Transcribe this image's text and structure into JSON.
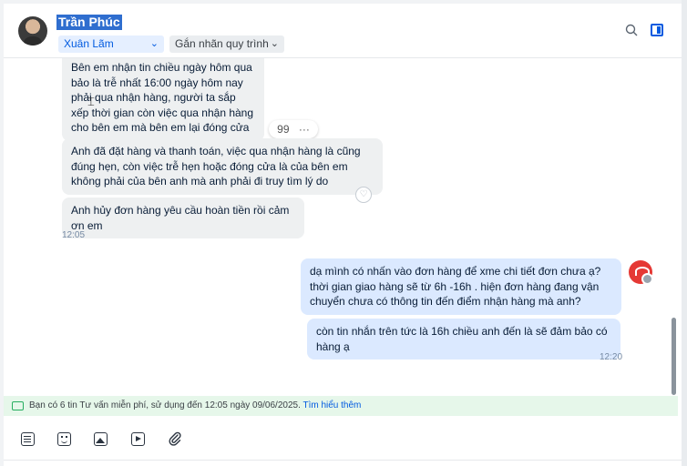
{
  "header": {
    "contact_name": "Trần Phúc",
    "assignee_select": "Xuân Lãm",
    "tag_select": "Gắn nhãn quy trình",
    "icons": [
      "search-icon",
      "toggle-panel-icon"
    ]
  },
  "messages": [
    {
      "side": "in",
      "text": "Bên em nhận tin chiều ngày hôm qua bảo là trễ nhất 16:00 ngày hôm nay phải qua nhận hàng, người ta sắp xếp thời gian còn việc qua nhận hàng cho bên em mà bên em lại đóng cửa"
    },
    {
      "side": "in",
      "text": "Anh đã đặt hàng và thanh toán, việc qua nhận hàng là cũng đúng hẹn, còn việc trễ hẹn hoặc đóng cửa là của bên em không phải của bên anh mà anh phải đi truy tìm lý do"
    },
    {
      "side": "in",
      "text": "Anh hủy đơn hàng yêu cầu hoàn tiền rồi cảm ơn em"
    },
    {
      "side": "out",
      "text": "dạ mình có nhấn vào đơn hàng để xme chi tiết đơn chưa ạ? thời gian giao hàng sẽ từ 6h -16h . hiện đơn hàng đang vận chuyển chưa có thông tin đến điểm nhận hàng mà anh?"
    },
    {
      "side": "out",
      "text": "còn tin nhắn trên tức là 16h chiều anh đến là sẽ đảm bảo có hàng ạ"
    }
  ],
  "times": {
    "incoming": "12:05",
    "outgoing": "12:20"
  },
  "reaction_bar": {
    "quote": "99",
    "more": "···"
  },
  "notice": {
    "text": "Bạn có 6 tin Tư vấn miễn phí, sử dụng đến 12:05 ngày 09/06/2025.",
    "link": "Tìm hiểu thêm"
  },
  "toolbar": {
    "icons": [
      "text-format-icon",
      "sticker-icon",
      "image-icon",
      "video-icon",
      "attachment-icon"
    ]
  },
  "colors": {
    "accent": "#005ae0",
    "incoming_bubble": "#eef0f1",
    "outgoing_bubble": "#dbe9ff",
    "notice_bg": "#e6f7ea"
  }
}
